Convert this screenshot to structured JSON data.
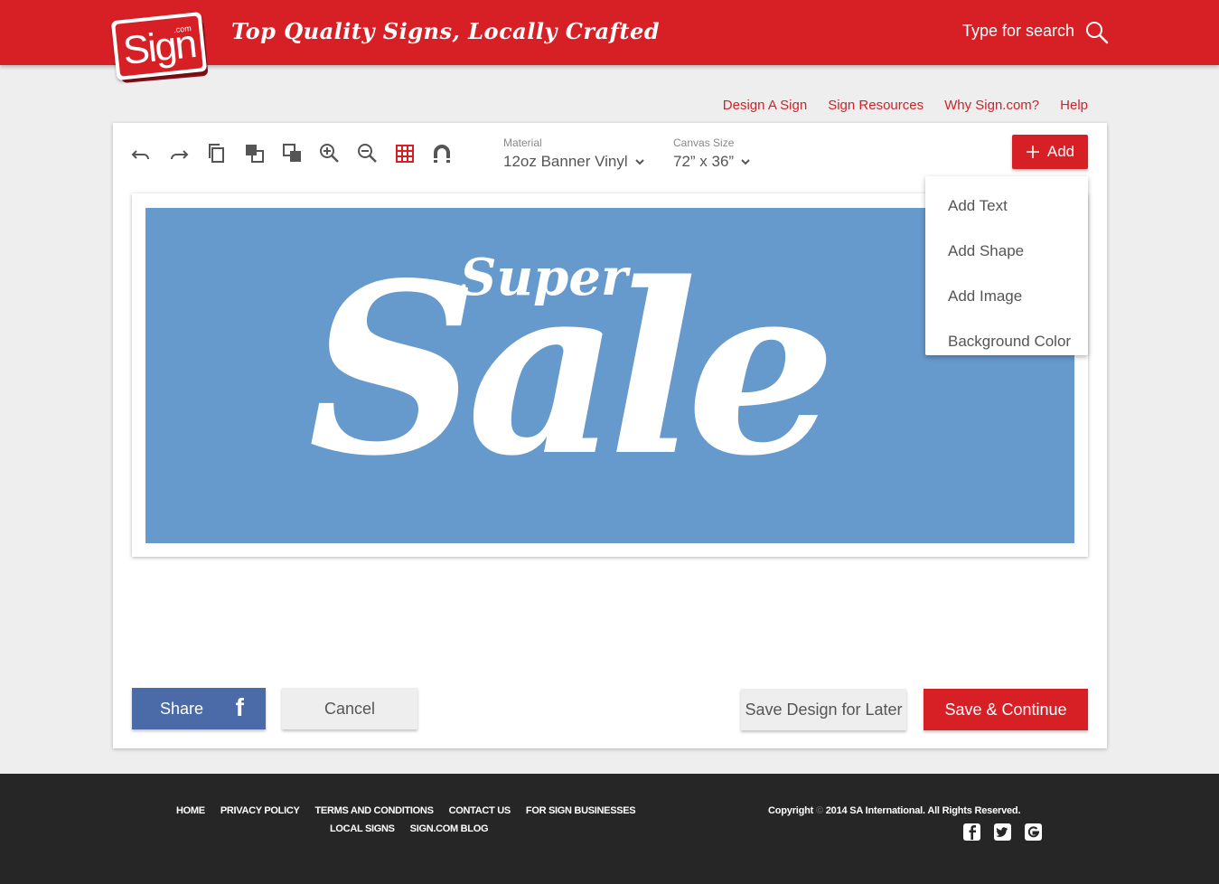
{
  "header": {
    "logo_text": "Sign",
    "logo_dotcom": ".com",
    "tagline": "Top Quality Signs, Locally Crafted",
    "search_placeholder": "Type for search"
  },
  "nav": {
    "items": [
      {
        "label": "Design A Sign"
      },
      {
        "label": "Sign Resources"
      },
      {
        "label": "Why Sign.com?"
      },
      {
        "label": "Help"
      }
    ]
  },
  "toolbar": {
    "tools": [
      "undo-icon",
      "redo-icon",
      "copy-icon",
      "bring-forward-icon",
      "send-backward-icon",
      "zoom-in-icon",
      "zoom-out-icon",
      "grid-icon",
      "magnet-icon"
    ],
    "material_label": "Material",
    "material_value": "12oz Banner Vinyl",
    "canvas_size_label": "Canvas Size",
    "canvas_size_value": "72” x 36”",
    "add_label": "Add"
  },
  "add_menu": {
    "items": [
      {
        "label": "Add Text"
      },
      {
        "label": "Add Shape"
      },
      {
        "label": "Add Image"
      },
      {
        "label": "Background Color"
      }
    ]
  },
  "canvas": {
    "background_color": "#6699cc",
    "text_small": "Super",
    "text_large": "Sale"
  },
  "actions": {
    "share_label": "Share",
    "cancel_label": "Cancel",
    "save_later_label": "Save Design for Later",
    "save_continue_label": "Save & Continue"
  },
  "footer": {
    "links_row1": [
      "HOME",
      "PRIVACY POLICY",
      "TERMS AND CONDITIONS",
      "CONTACT US",
      "FOR SIGN BUSINESSES"
    ],
    "links_row2": [
      "LOCAL SIGNS",
      "SIGN.COM BLOG"
    ],
    "copyright_prefix": "Copyright",
    "copyright_symbol": "©",
    "copyright_suffix": "2014 SA International. All Rights Reserved.",
    "social": [
      "facebook-icon",
      "twitter-icon",
      "google-plus-icon"
    ]
  },
  "colors": {
    "brand_red": "#d71f26",
    "facebook_blue": "#4a6aa8",
    "footer_bg": "#262626"
  }
}
